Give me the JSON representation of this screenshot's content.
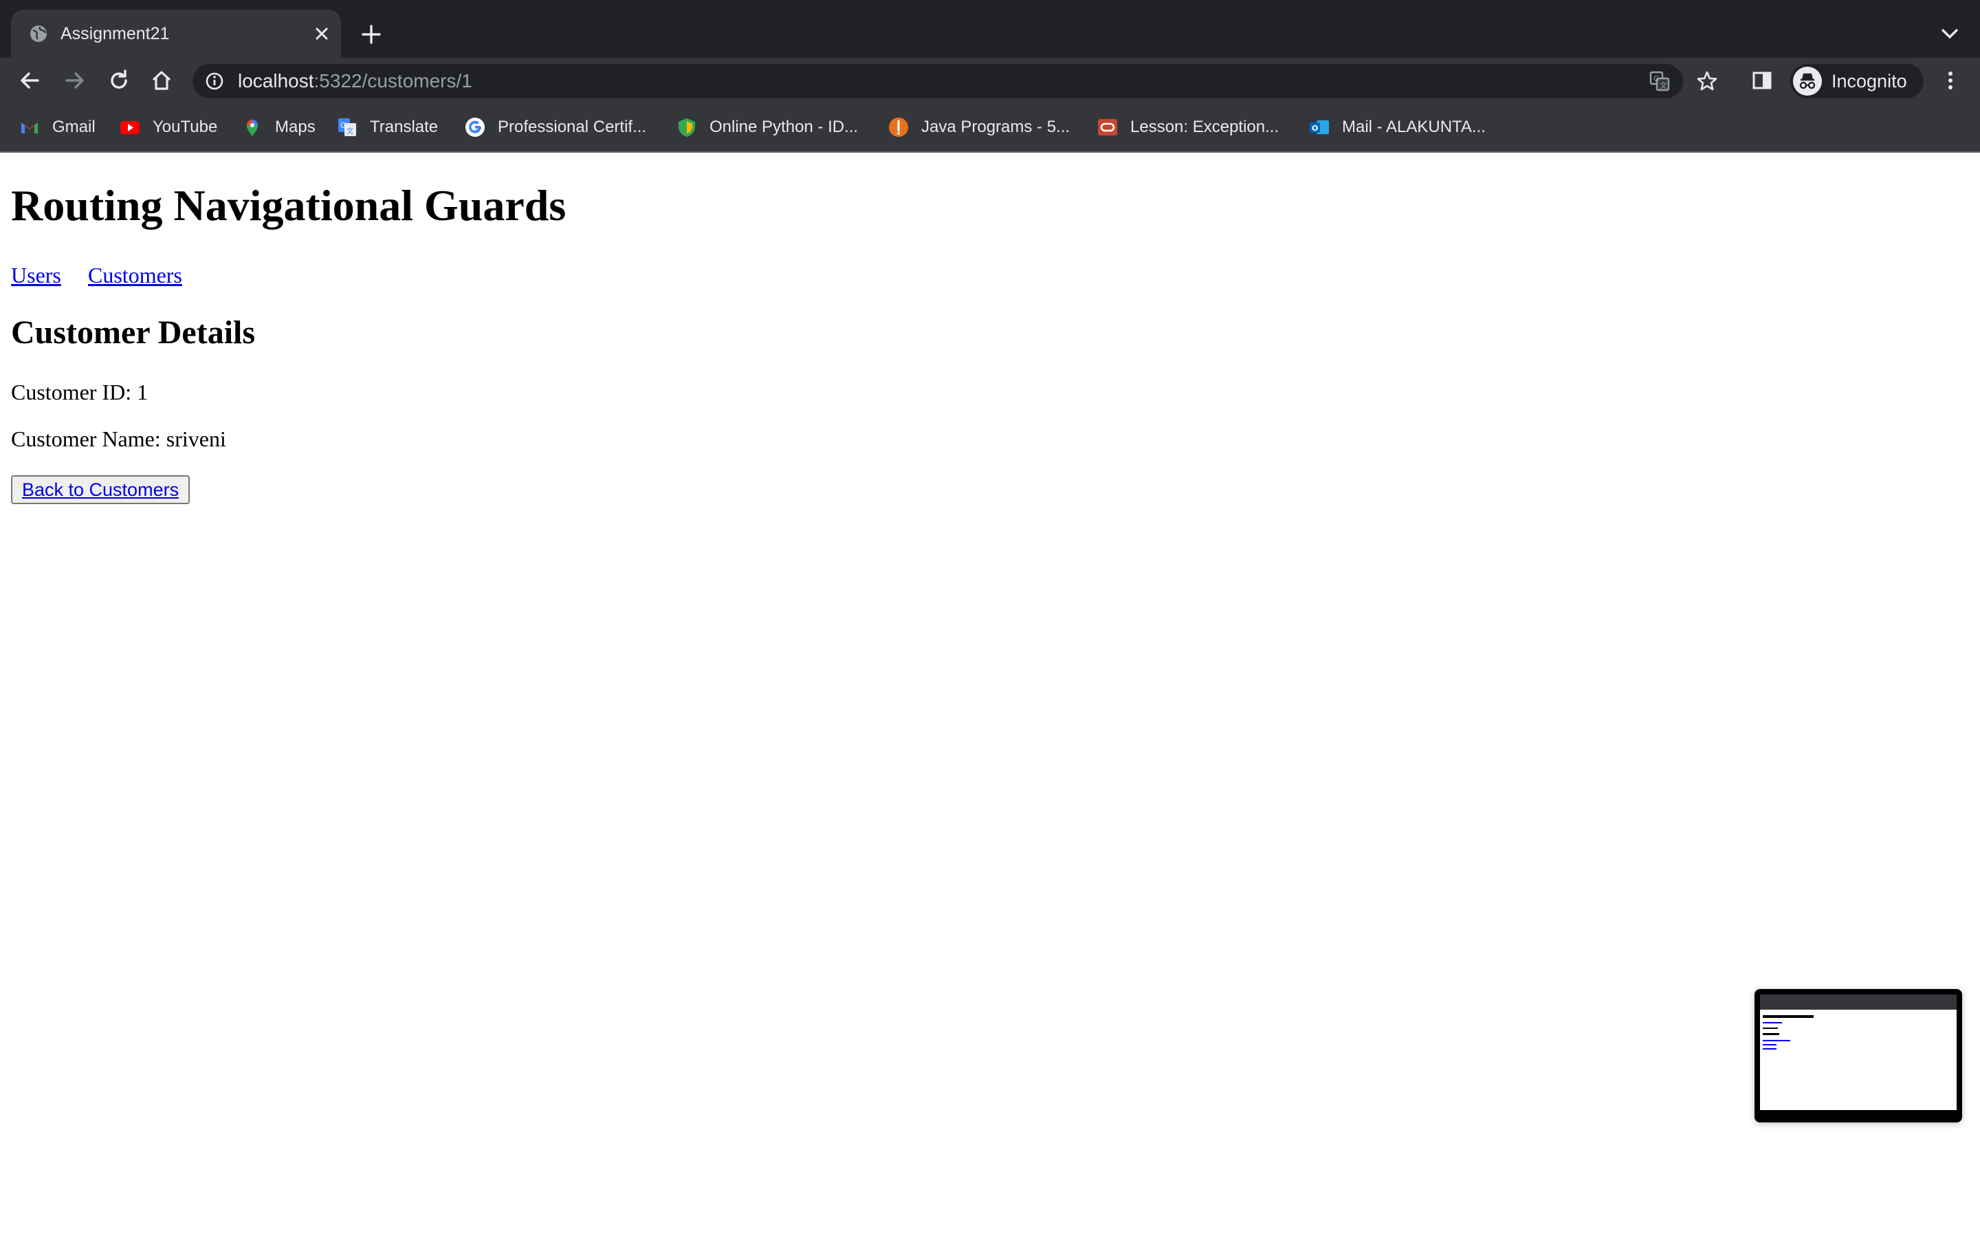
{
  "browser": {
    "tab": {
      "title": "Assignment21"
    },
    "address": {
      "host": "localhost",
      "rest": ":5322/customers/1"
    },
    "profile": {
      "label": "Incognito"
    },
    "bookmarks": [
      {
        "label": "Gmail",
        "icon": "gmail-icon"
      },
      {
        "label": "YouTube",
        "icon": "youtube-icon"
      },
      {
        "label": "Maps",
        "icon": "maps-icon"
      },
      {
        "label": "Translate",
        "icon": "translate-icon"
      },
      {
        "label": "Professional Certif...",
        "icon": "google-icon"
      },
      {
        "label": "Online Python - ID...",
        "icon": "python-ide-icon"
      },
      {
        "label": "Java Programs - 5...",
        "icon": "java-programs-icon"
      },
      {
        "label": "Lesson: Exception...",
        "icon": "oracle-icon"
      },
      {
        "label": "Mail - ALAKUNTA...",
        "icon": "outlook-icon"
      }
    ]
  },
  "page": {
    "title": "Routing Navigational Guards",
    "nav": {
      "users": "Users",
      "customers": "Customers"
    },
    "section_title": "Customer Details",
    "customer_id_line": "Customer ID: 1",
    "customer_name_line": "Customer Name: sriveni",
    "back_button": "Back to Customers"
  },
  "colors": {
    "chrome_dark": "#202124",
    "chrome_toolbar": "#35363a",
    "link": "#0000ee"
  }
}
